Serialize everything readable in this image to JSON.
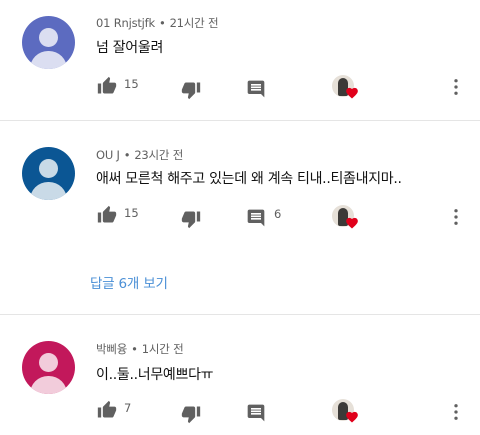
{
  "comments": [
    {
      "author": "01 Rnjstjfk",
      "separator": "•",
      "time": "21시간 전",
      "text": "넘 잘어울려",
      "likes": "15",
      "replies_count": "",
      "avatar_color": "#5c6bc0"
    },
    {
      "author": "OU J",
      "separator": "•",
      "time": "23시간 전",
      "text": "애써 모른척 해주고 있는데 왜 계속 티내..티좀내지마..",
      "likes": "15",
      "replies_count": "6",
      "avatar_color": "#0b5694"
    },
    {
      "author": "박삐융",
      "separator": "•",
      "time": "1시간 전",
      "text": "이..둘..너무예쁘다ㅠ",
      "likes": "7",
      "replies_count": "",
      "avatar_color": "#c2185b"
    }
  ],
  "view_replies_label": "답글 6개 보기",
  "icons": {
    "like": "thumb-up-icon",
    "dislike": "thumb-down-icon",
    "reply": "comment-icon",
    "creator": "creator-heart",
    "more": "more-vert-icon"
  },
  "colors": {
    "icon": "#606060",
    "link": "#4a8fd6",
    "heart": "#e0001b"
  }
}
